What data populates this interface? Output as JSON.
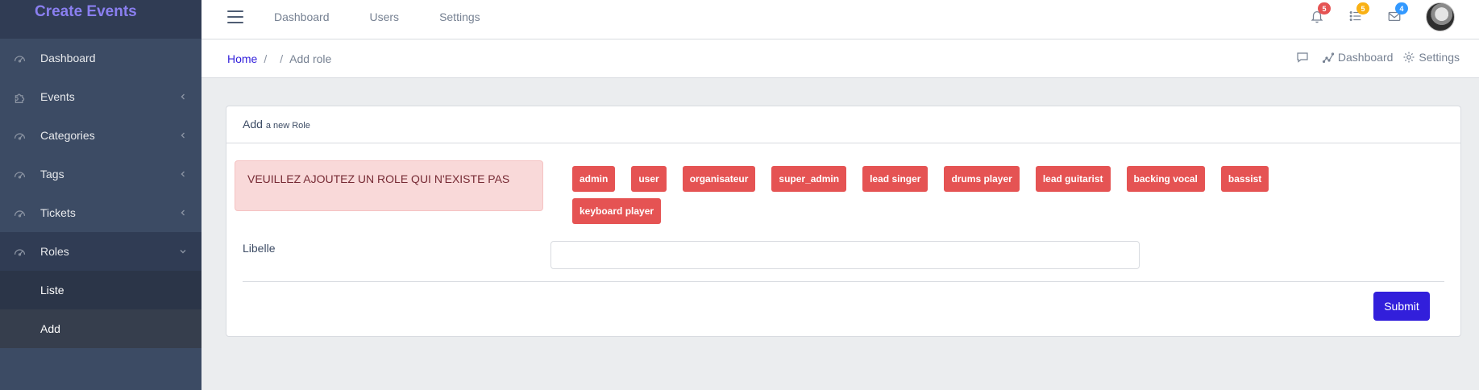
{
  "brand": {
    "title": "Create Events"
  },
  "sidebar": {
    "items": [
      {
        "label": "Dashboard",
        "icon": "speedometer-icon"
      },
      {
        "label": "Events",
        "icon": "puzzle-icon"
      },
      {
        "label": "Categories",
        "icon": "speedometer-icon"
      },
      {
        "label": "Tags",
        "icon": "speedometer-icon"
      },
      {
        "label": "Tickets",
        "icon": "speedometer-icon"
      },
      {
        "label": "Roles",
        "icon": "speedometer-icon"
      }
    ],
    "roles_sub": [
      {
        "label": "Liste"
      },
      {
        "label": "Add"
      }
    ]
  },
  "header": {
    "nav": [
      {
        "label": "Dashboard"
      },
      {
        "label": "Users"
      },
      {
        "label": "Settings"
      }
    ],
    "badges": {
      "bell": "5",
      "list": "5",
      "envelope": "4"
    },
    "colors": {
      "bell": "#e55353",
      "list": "#f9b115",
      "envelope": "#39f"
    }
  },
  "subheader": {
    "breadcrumb": {
      "home": "Home",
      "separator_1": "/",
      "separator_2": "/",
      "current": "Add role"
    },
    "right": {
      "dashboard": "Dashboard",
      "settings": "Settings"
    }
  },
  "card": {
    "title": "Add",
    "subtitle": "a new Role",
    "alert": "VEUILLEZ AJOUTEZ UN ROLE QUI N'EXISTE PAS",
    "roles": [
      "admin",
      "user",
      "organisateur",
      "super_admin",
      "lead singer",
      "drums player",
      "lead guitarist",
      "backing vocal",
      "bassist",
      "keyboard player"
    ],
    "field_label": "Libelle",
    "field_value": "",
    "submit": "Submit"
  }
}
